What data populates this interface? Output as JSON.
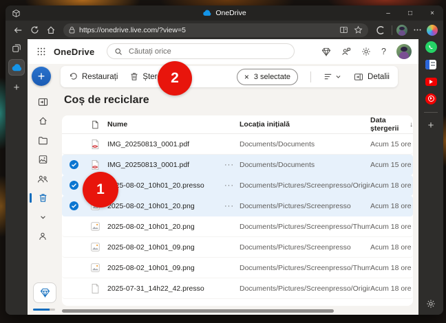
{
  "browser": {
    "tab_title": "OneDrive",
    "url": "https://onedrive.live.com/?view=5"
  },
  "icons": {
    "minimize": "–",
    "maximize": "□",
    "close": "×",
    "more_options": "···",
    "help": "?",
    "deselect_x": "×",
    "sort_desc_arrow": "↓",
    "plus": "+"
  },
  "header": {
    "app_name": "OneDrive",
    "search_placeholder": "Căutați orice"
  },
  "toolbar": {
    "restore_label": "Restaurați",
    "delete_label": "Ștergere",
    "selected_label": "3 selectate",
    "details_label": "Detalii"
  },
  "page": {
    "title": "Coș de reciclare"
  },
  "table": {
    "columns": {
      "name": "Nume",
      "location": "Locația inițială",
      "deleted": "Data ștergerii"
    },
    "rows": [
      {
        "name": "IMG_20250813_0001.pdf",
        "location": "Documents/Documents",
        "deleted": "Acum 15 ore",
        "type": "pdf",
        "selected": false
      },
      {
        "name": "IMG_20250813_0001.pdf",
        "location": "Documents/Documents",
        "deleted": "Acum 15 ore",
        "type": "pdf",
        "selected": true
      },
      {
        "name": "2025-08-02_10h01_20.presso",
        "location": "Documents/Pictures/Screenpresso/Originals",
        "deleted": "Acum 18 ore",
        "type": "file",
        "selected": true
      },
      {
        "name": "2025-08-02_10h01_20.png",
        "location": "Documents/Pictures/Screenpresso",
        "deleted": "Acum 18 ore",
        "type": "image",
        "selected": true
      },
      {
        "name": "2025-08-02_10h01_20.png",
        "location": "Documents/Pictures/Screenpresso/Thumbn...",
        "deleted": "Acum 18 ore",
        "type": "image",
        "selected": false
      },
      {
        "name": "2025-08-02_10h01_09.png",
        "location": "Documents/Pictures/Screenpresso",
        "deleted": "Acum 18 ore",
        "type": "image",
        "selected": false
      },
      {
        "name": "2025-08-02_10h01_09.png",
        "location": "Documents/Pictures/Screenpresso/Thumbn...",
        "deleted": "Acum 18 ore",
        "type": "image",
        "selected": false
      },
      {
        "name": "2025-07-31_14h22_42.presso",
        "location": "Documents/Pictures/Screenpresso/Originals",
        "deleted": "Acum 18 ore",
        "type": "file",
        "selected": false
      }
    ]
  },
  "annotations": {
    "step1": "1",
    "step2": "2"
  },
  "colors": {
    "accent_blue": "#0f6cbd",
    "onedrive_cloud": "#1494e8",
    "selection_bg": "#e7f1fb",
    "annotation_red": "#e8150c",
    "pdf_red": "#d13438",
    "whatsapp_green": "#25d366",
    "youtube_red": "#f20000"
  }
}
